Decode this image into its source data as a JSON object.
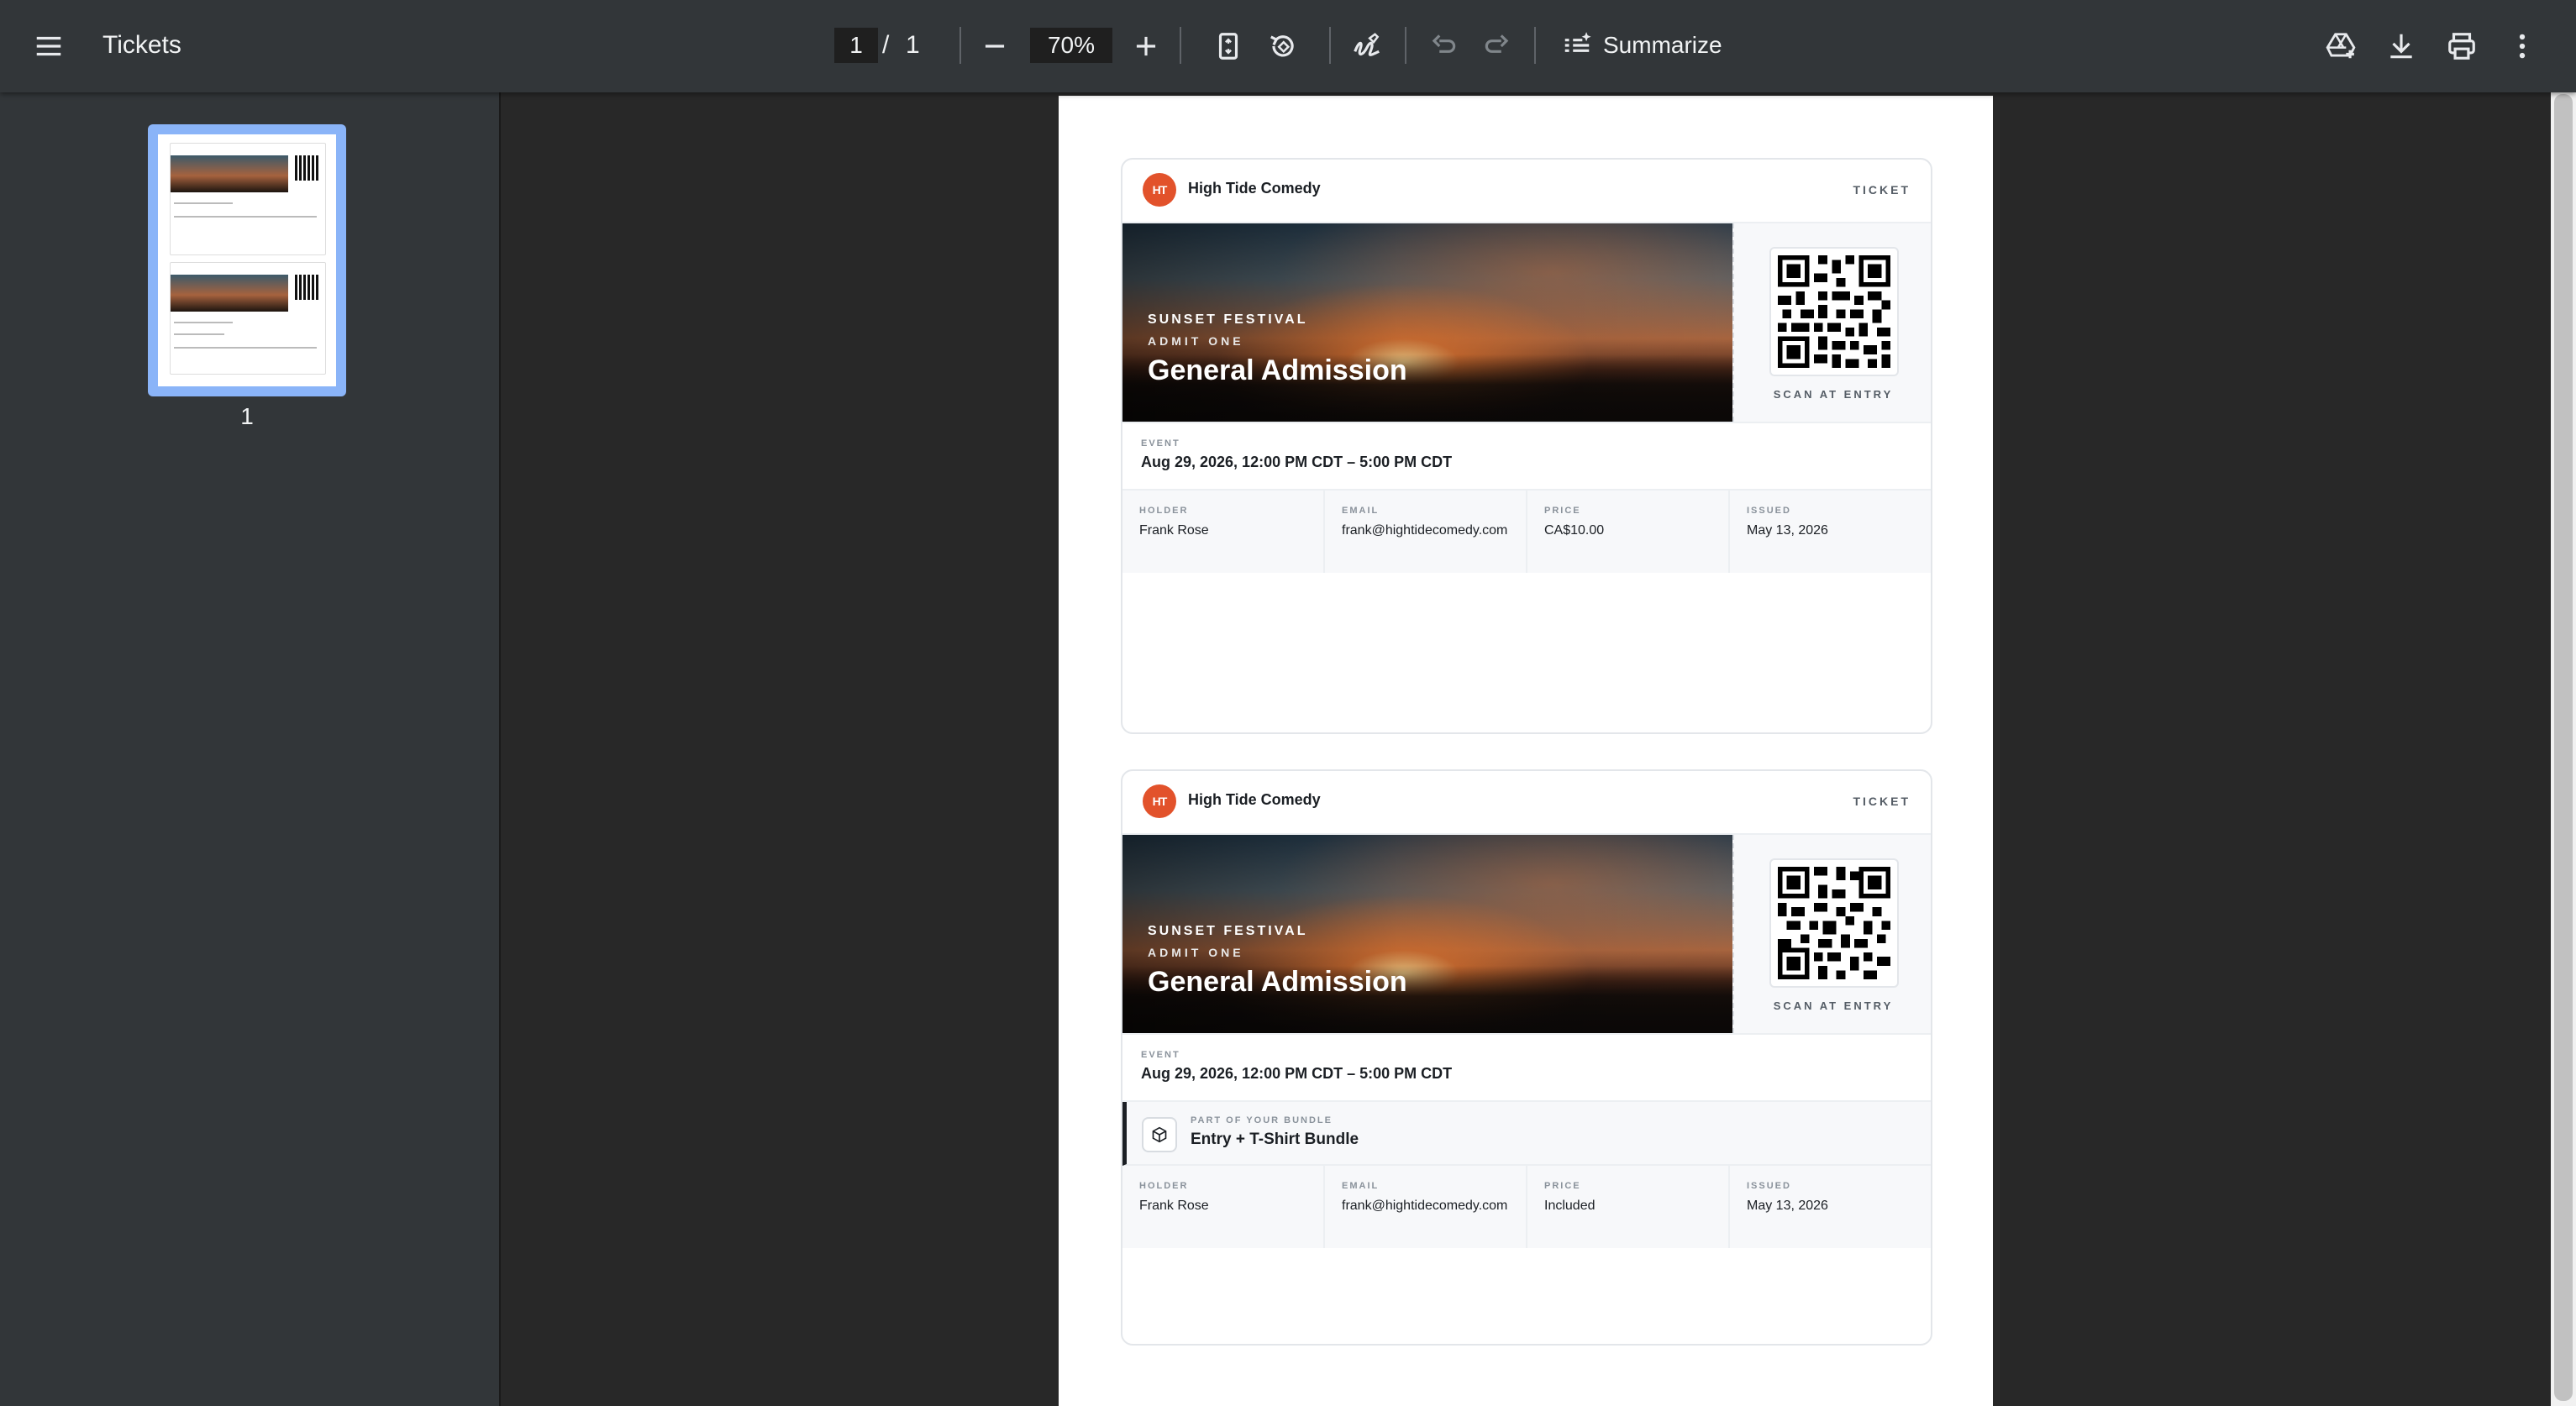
{
  "toolbar": {
    "title": "Tickets",
    "page_current": "1",
    "page_separator": "/",
    "page_total": "1",
    "zoom": "70%",
    "summarize_label": "Summarize"
  },
  "sidebar": {
    "thumbnail_page_number": "1"
  },
  "tickets": [
    {
      "brand": "High Tide Comedy",
      "label": "TICKET",
      "festival": "SUNSET FESTIVAL",
      "admit": "ADMIT ONE",
      "title": "General Admission",
      "scan": "SCAN AT ENTRY",
      "event_label": "EVENT",
      "event_value": "Aug 29, 2026, 12:00 PM CDT – 5:00 PM CDT",
      "holder_label": "HOLDER",
      "holder": "Frank Rose",
      "email_label": "EMAIL",
      "email": "frank@hightidecomedy.com",
      "price_label": "PRICE",
      "price": "CA$10.00",
      "issued_label": "ISSUED",
      "issued": "May 13, 2026"
    },
    {
      "brand": "High Tide Comedy",
      "label": "TICKET",
      "festival": "SUNSET FESTIVAL",
      "admit": "ADMIT ONE",
      "title": "General Admission",
      "scan": "SCAN AT ENTRY",
      "event_label": "EVENT",
      "event_value": "Aug 29, 2026, 12:00 PM CDT – 5:00 PM CDT",
      "bundle_label": "PART OF YOUR BUNDLE",
      "bundle_value": "Entry + T-Shirt Bundle",
      "holder_label": "HOLDER",
      "holder": "Frank Rose",
      "email_label": "EMAIL",
      "email": "frank@hightidecomedy.com",
      "price_label": "PRICE",
      "price": "Included",
      "issued_label": "ISSUED",
      "issued": "May 13, 2026"
    }
  ],
  "icons": {
    "menu": "menu-icon",
    "zoom_out": "minus-icon",
    "zoom_in": "plus-icon",
    "fit_page": "fit-page-icon",
    "rotate": "rotate-icon",
    "annotate": "draw-icon",
    "undo": "undo-icon",
    "redo": "redo-icon",
    "summarize": "summarize-icon",
    "drive": "save-to-drive-icon",
    "download": "download-icon",
    "print": "print-icon",
    "more": "more-vertical-icon",
    "bundle": "package-icon"
  },
  "colors": {
    "toolbar_bg": "#323639",
    "viewer_bg": "#282828",
    "brand_orange": "#e2522b",
    "thumb_highlight": "#8ab4f8"
  }
}
